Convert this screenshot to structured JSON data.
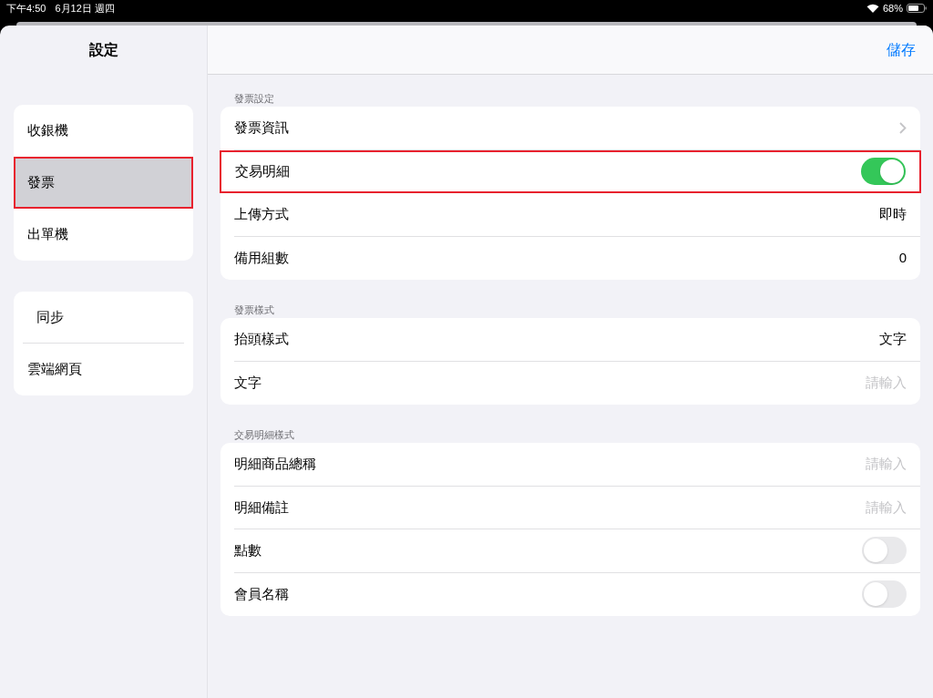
{
  "status_bar": {
    "time": "下午4:50",
    "date": "6月12日 週四",
    "battery": "68%"
  },
  "sidebar": {
    "title": "設定",
    "groups": [
      [
        {
          "label": "收銀機",
          "selected": false,
          "highlighted": false
        },
        {
          "label": "發票",
          "selected": true,
          "highlighted": true
        },
        {
          "label": "出單機",
          "selected": false,
          "highlighted": false
        }
      ],
      [
        {
          "label": "同步",
          "selected": false,
          "highlighted": false
        },
        {
          "label": "雲端網頁",
          "selected": false,
          "highlighted": false
        }
      ]
    ]
  },
  "header": {
    "save": "儲存"
  },
  "sections": [
    {
      "title": "發票設定",
      "rows": [
        {
          "kind": "chevron",
          "label": "發票資訊",
          "highlighted": false
        },
        {
          "kind": "toggle",
          "label": "交易明細",
          "on": true,
          "highlighted": true
        },
        {
          "kind": "value",
          "label": "上傳方式",
          "value": "即時",
          "highlighted": false
        },
        {
          "kind": "value",
          "label": "備用組數",
          "value": "0",
          "highlighted": false
        }
      ]
    },
    {
      "title": "發票樣式",
      "rows": [
        {
          "kind": "value",
          "label": "抬頭樣式",
          "value": "文字",
          "highlighted": false
        },
        {
          "kind": "input",
          "label": "文字",
          "placeholder": "請輸入",
          "highlighted": false
        }
      ]
    },
    {
      "title": "交易明細樣式",
      "rows": [
        {
          "kind": "input",
          "label": "明細商品總稱",
          "placeholder": "請輸入",
          "highlighted": false
        },
        {
          "kind": "input",
          "label": "明細備註",
          "placeholder": "請輸入",
          "highlighted": false
        },
        {
          "kind": "toggle",
          "label": "點數",
          "on": false,
          "highlighted": false
        },
        {
          "kind": "toggle",
          "label": "會員名稱",
          "on": false,
          "highlighted": false
        }
      ]
    }
  ]
}
